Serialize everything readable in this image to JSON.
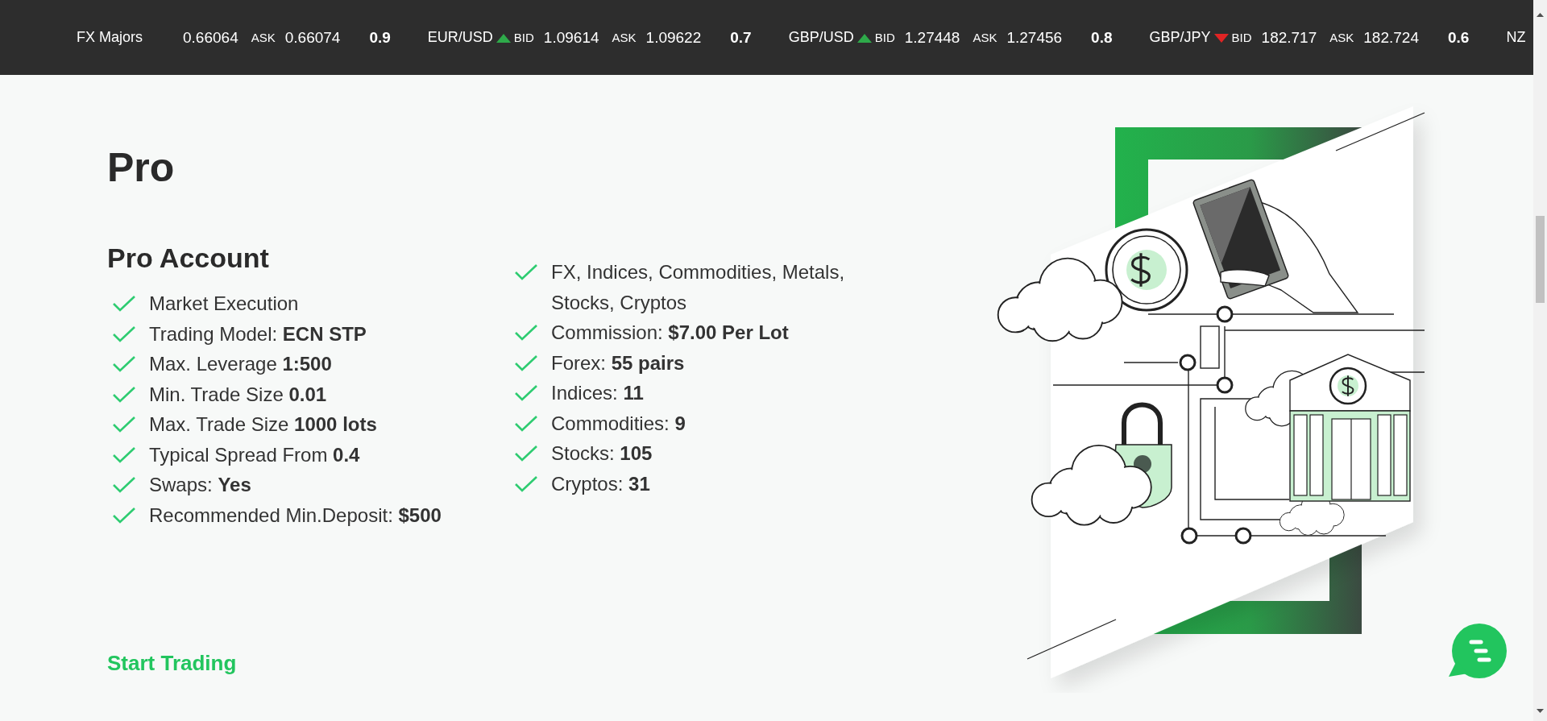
{
  "ticker": {
    "label": "FX Majors",
    "quotes": [
      {
        "bid": "0.66064",
        "ask_label": "ASK",
        "ask": "0.66074",
        "spread": "0.9"
      },
      {
        "pair": "EUR/USD",
        "rising": true,
        "bid_label": "BID",
        "bid": "1.09614",
        "ask_label": "ASK",
        "ask": "1.09622",
        "spread": "0.7"
      },
      {
        "pair": "GBP/USD",
        "rising": true,
        "bid_label": "BID",
        "bid": "1.27448",
        "ask_label": "ASK",
        "ask": "1.27456",
        "spread": "0.8"
      },
      {
        "pair": "GBP/JPY",
        "rising": false,
        "bid_label": "BID",
        "bid": "182.717",
        "ask_label": "ASK",
        "ask": "182.724",
        "spread": "0.6"
      },
      {
        "pair": "NZ"
      }
    ]
  },
  "plan": {
    "title": "Pro",
    "subtitle": "Pro Account",
    "features_left": [
      "Market Execution",
      "Trading Model: **ECN STP**",
      "Max. Leverage **1:500**",
      "Min. Trade Size **0.01**",
      "Max. Trade Size **1000 lots**",
      "Typical Spread From **0.4**",
      "Swaps: **Yes**",
      "Recommended Min.Deposit: **$500**"
    ],
    "features_right": [
      "FX, Indices, Commodities, Metals, Stocks, Cryptos",
      "Commission: **$7.00 Per Lot**",
      "Forex: **55 pairs**",
      "Indices: **11**",
      "Commodities: **9**",
      "Stocks: **105**",
      "Cryptos: **31**"
    ],
    "cta": "Start Trading"
  }
}
